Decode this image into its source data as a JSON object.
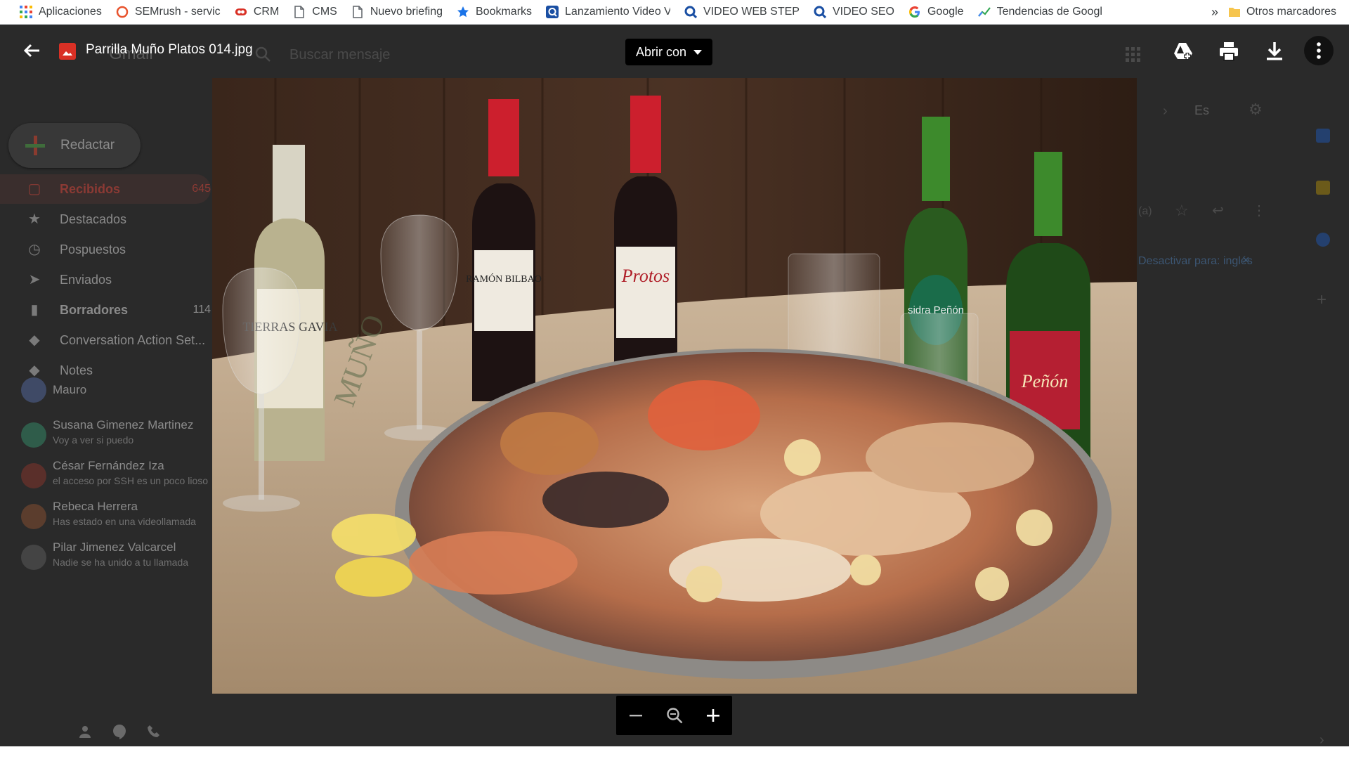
{
  "bookmarks": {
    "items": [
      {
        "label": "Aplicaciones",
        "icon": "apps-grid-icon"
      },
      {
        "label": "SEMrush - service for",
        "icon": "semrush-icon"
      },
      {
        "label": "CRM",
        "icon": "crm-icon"
      },
      {
        "label": "CMS",
        "icon": "page-icon"
      },
      {
        "label": "Nuevo briefing",
        "icon": "page-icon"
      },
      {
        "label": "Bookmarks",
        "icon": "star-icon"
      },
      {
        "label": "Lanzamiento Video V",
        "icon": "q-icon"
      },
      {
        "label": "VIDEO WEB STEP",
        "icon": "q-search-icon"
      },
      {
        "label": "VIDEO SEO",
        "icon": "q-search-icon"
      },
      {
        "label": "Google",
        "icon": "google-icon"
      },
      {
        "label": "Tendencias de Googl",
        "icon": "trends-icon"
      }
    ],
    "overflow": "»",
    "other": "Otros marcadores"
  },
  "gmail": {
    "logo": "Gmail",
    "search_placeholder": "Buscar mensaje",
    "compose": "Redactar",
    "nav": [
      {
        "label": "Recibidos",
        "count": "645",
        "icon": "inbox-icon"
      },
      {
        "label": "Destacados",
        "count": "",
        "icon": "star-icon"
      },
      {
        "label": "Pospuestos",
        "count": "",
        "icon": "clock-icon"
      },
      {
        "label": "Enviados",
        "count": "",
        "icon": "send-icon"
      },
      {
        "label": "Borradores",
        "count": "114",
        "icon": "draft-icon"
      },
      {
        "label": "Conversation Action Set...",
        "count": "",
        "icon": "label-icon"
      },
      {
        "label": "Notes",
        "count": "",
        "icon": "label-icon"
      }
    ],
    "hangouts_user": "Mauro",
    "contacts": [
      {
        "name": "Susana Gimenez Martinez",
        "snippet": "Voy a ver si puedo"
      },
      {
        "name": "César Fernández Iza",
        "snippet": "el acceso por SSH es un poco lioso"
      },
      {
        "name": "Rebeca Herrera",
        "snippet": "Has estado en una videollamada"
      },
      {
        "name": "Pilar Jimenez Valcarcel",
        "snippet": "Nadie se ha unido a tu llamada"
      }
    ],
    "right": {
      "lang": "Es",
      "translate_text": "Desactivar para: inglés",
      "truncated": "(a)"
    }
  },
  "viewer": {
    "file_name": "Parrilla Muño Platos 014.jpg",
    "open_with": "Abrir con",
    "toolbar_icons": [
      "drive-add-icon",
      "print-icon",
      "download-icon",
      "more-vert-icon"
    ],
    "zoom": [
      "zoom-out-icon",
      "zoom-reset-icon",
      "zoom-in-icon"
    ]
  },
  "photo": {
    "bottle_labels": [
      "TIERRAS GAVIA",
      "RAMÓN BILBAO",
      "Protos",
      "sidra Peñón",
      "Peñón"
    ],
    "placemat_text": "MUÑO"
  },
  "colors": {
    "viewer_bg": "#1f1f1f",
    "overlay_text": "#ffffff",
    "gmail_accent": "#8b3a34"
  }
}
